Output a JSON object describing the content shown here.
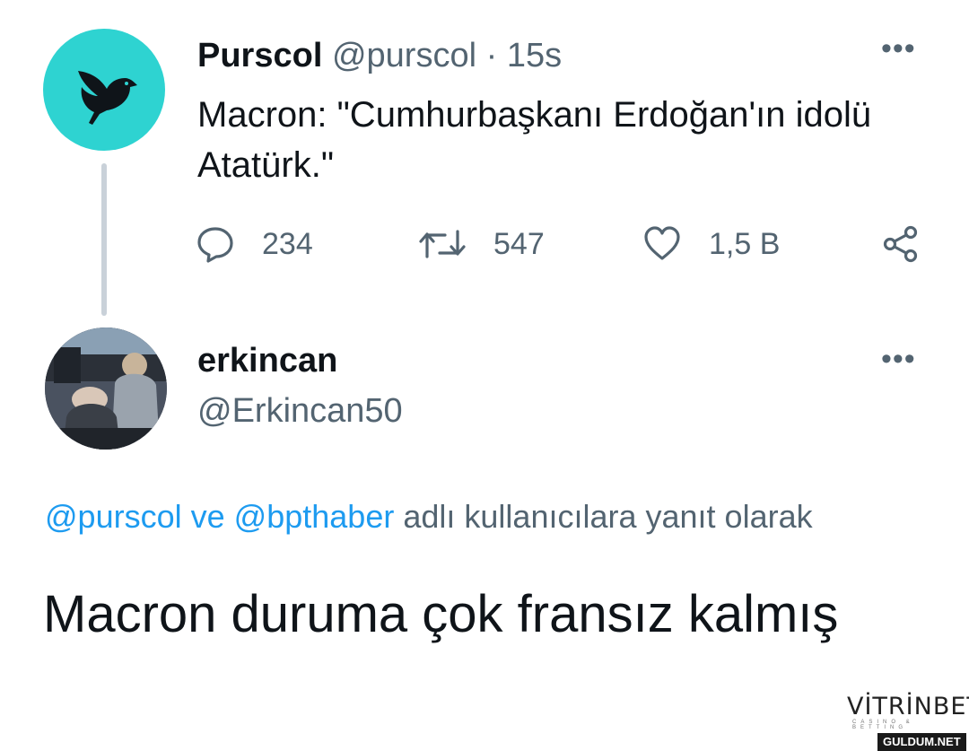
{
  "tweet1": {
    "name": "Purscol",
    "handle": "@purscol",
    "separator": "·",
    "time": "15s",
    "text": "Macron: \"Cumhurbaşkanı Erdoğan'ın idolü Atatürk.\"",
    "avatar_color": "#2ed3d1",
    "more": "•••",
    "actions": {
      "replies": "234",
      "retweets": "547",
      "likes": "1,5 B"
    }
  },
  "tweet2": {
    "name": "erkincan",
    "handle": "@Erkincan50",
    "more": "•••",
    "reply_to": {
      "mention1": "@purscol",
      "joiner": "ve",
      "mention2": "@bpthaber",
      "suffix": "adlı kullanıcılara yanıt olarak"
    },
    "text": "Macron duruma çok fransız kalmış"
  },
  "watermark": {
    "brand": "VİTRİNBET",
    "tagline": "CASINO & BETTING",
    "site": "GULDUM.NET"
  },
  "colors": {
    "text": "#0f1419",
    "muted": "#536471",
    "link": "#1d9bf0",
    "thread_line": "#c9d1d9"
  }
}
